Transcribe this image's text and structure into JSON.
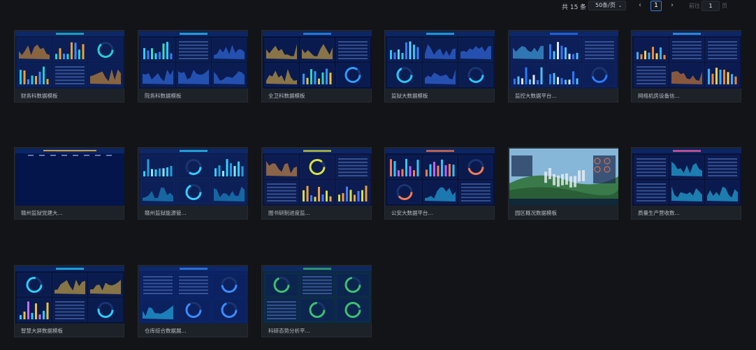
{
  "pagination": {
    "total": "共 15 条",
    "page_size": "50条/页",
    "current_page": "1",
    "goto_prefix": "前往",
    "goto_value": "1",
    "goto_suffix": "页"
  },
  "templates": [
    {
      "title": "财务科数据模板"
    },
    {
      "title": "院务科数据模板"
    },
    {
      "title": "全卫科数据模板"
    },
    {
      "title": "监狱大数据模板"
    },
    {
      "title": "监控大数据平台..."
    },
    {
      "title": "网络机房设备信..."
    },
    {
      "title": "赣州监狱党建大..."
    },
    {
      "title": "赣州监狱能源管..."
    },
    {
      "title": "图书研制进度监..."
    },
    {
      "title": "公安大数据平台..."
    },
    {
      "title": "园区概况数据模板"
    },
    {
      "title": "质量生产营收数..."
    },
    {
      "title": "智慧大屏数据模板"
    },
    {
      "title": "仓库综合数据展..."
    },
    {
      "title": "科研态势分析平..."
    }
  ],
  "thumb_themes": [
    "finance",
    "affairs",
    "health",
    "prison",
    "monitor",
    "network",
    "party",
    "energy",
    "progress",
    "police",
    "park",
    "quality",
    "smart",
    "warehouse",
    "research"
  ]
}
